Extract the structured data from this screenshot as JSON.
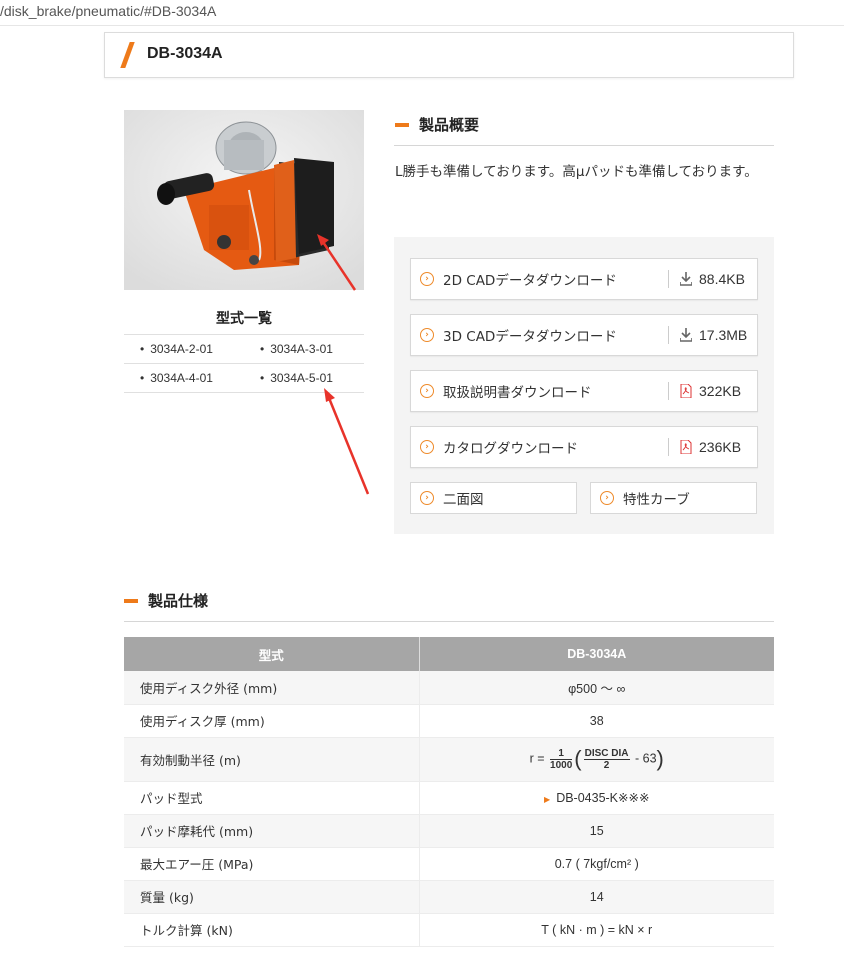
{
  "url": "/disk_brake/pneumatic/#DB-3034A",
  "page_title": "DB-3034A",
  "models": {
    "title": "型式一覧",
    "items": [
      "3034A-2-01",
      "3034A-3-01",
      "3034A-4-01",
      "3034A-5-01"
    ]
  },
  "overview": {
    "heading": "製品概要",
    "text": "L勝手も準備しております。高μパッドも準備しております。"
  },
  "downloads": [
    {
      "label": "2D CADデータダウンロード",
      "size": "88.4KB",
      "icon": "download-icon"
    },
    {
      "label": "3D CADデータダウンロード",
      "size": "17.3MB",
      "icon": "download-icon"
    },
    {
      "label": "取扱説明書ダウンロード",
      "size": "322KB",
      "icon": "pdf-icon"
    },
    {
      "label": "カタログダウンロード",
      "size": "236KB",
      "icon": "pdf-icon"
    }
  ],
  "extra_buttons": [
    "二面図",
    "特性カーブ"
  ],
  "specs": {
    "heading": "製品仕様",
    "header": [
      "型式",
      "DB-3034A"
    ],
    "rows": [
      {
        "label": "使用ディスク外径 (mm)",
        "value": "φ500 ～ ∞"
      },
      {
        "label": "使用ディスク厚 (mm)",
        "value": "38"
      },
      {
        "label": "有効制動半径 (m)",
        "value": "r = 1/1000 (DISC DIA/2 - 63)",
        "formula": {
          "prefix": "r =",
          "frac1_num": "1",
          "frac1_den": "1000",
          "frac2_num": "DISC DIA",
          "frac2_den": "2",
          "suffix": "- 63"
        }
      },
      {
        "label": "パッド型式",
        "value": "DB-0435-K※※※"
      },
      {
        "label": "パッド摩耗代 (mm)",
        "value": "15"
      },
      {
        "label": "最大エアー圧 (MPa)",
        "value": "0.7 ( 7kgf/cm² )"
      },
      {
        "label": "質量 (kg)",
        "value": "14"
      },
      {
        "label": "トルク計算 (kN)",
        "value": "T ( kN · m ) = kN × r"
      }
    ]
  },
  "colors": {
    "accent": "#ee7a1a",
    "table_header": "#a6a6a6",
    "annotation_arrow": "#e8332a"
  }
}
